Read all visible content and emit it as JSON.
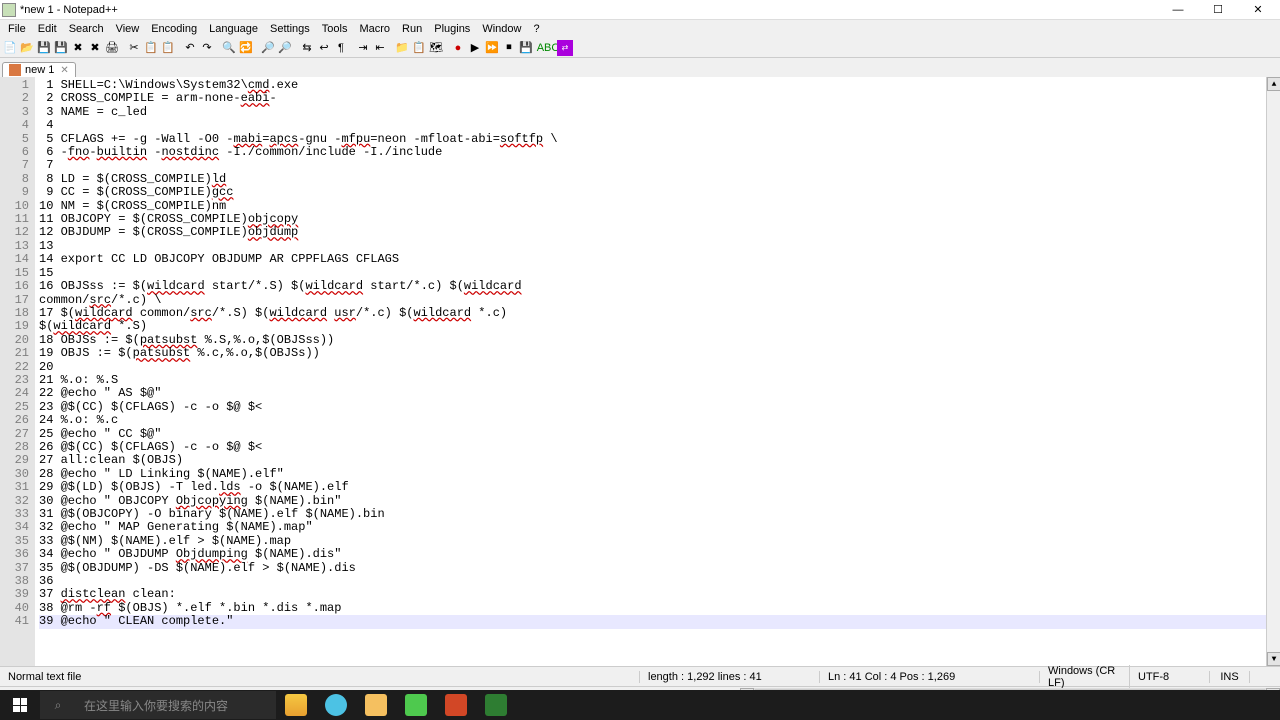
{
  "window": {
    "title": "*new 1 - Notepad++"
  },
  "menu": {
    "file": "File",
    "edit": "Edit",
    "search": "Search",
    "view": "View",
    "encoding": "Encoding",
    "language": "Language",
    "settings": "Settings",
    "tools": "Tools",
    "macro": "Macro",
    "run": "Run",
    "plugins": "Plugins",
    "window": "Window",
    "help": "?"
  },
  "tab": {
    "name": "new 1"
  },
  "gutter": [
    "1",
    "2",
    "3",
    "4",
    "5",
    "6",
    "7",
    "8",
    "9",
    "10",
    "11",
    "12",
    "13",
    "14",
    "15",
    "16",
    "17",
    "18",
    "19",
    "20",
    "21",
    "22",
    "23",
    "24",
    "25",
    "26",
    "27",
    "28",
    "29",
    "30",
    "31",
    "32",
    "33",
    "34",
    "35",
    "36",
    "37",
    "38",
    "39",
    "40",
    "41"
  ],
  "lines": [
    " 1 SHELL=C:\\Windows\\System32\\cmd.exe",
    " 2 CROSS_COMPILE = arm-none-eabi-",
    " 3 NAME = c_led",
    " 4",
    " 5 CFLAGS += -g -Wall -O0 -mabi=apcs-gnu -mfpu=neon -mfloat-abi=softfp \\",
    " 6 -fno-builtin -nostdinc -I./common/include -I./include",
    " 7",
    " 8 LD = $(CROSS_COMPILE)ld",
    " 9 CC = $(CROSS_COMPILE)gcc",
    "10 NM = $(CROSS_COMPILE)nm",
    "11 OBJCOPY = $(CROSS_COMPILE)objcopy",
    "12 OBJDUMP = $(CROSS_COMPILE)objdump",
    "13",
    "14 export CC LD OBJCOPY OBJDUMP AR CPPFLAGS CFLAGS",
    "15",
    "16 OBJSss := $(wildcard start/*.S) $(wildcard start/*.c) $(wildcard",
    "common/src/*.c) \\",
    "17 $(wildcard common/src/*.S) $(wildcard usr/*.c) $(wildcard *.c)",
    "$(wildcard *.S)",
    "18 OBJSs := $(patsubst %.S,%.o,$(OBJSss))",
    "19 OBJS := $(patsubst %.c,%.o,$(OBJSs))",
    "20",
    "21 %.o: %.S",
    "22 @echo \" AS $@\"",
    "23 @$(CC) $(CFLAGS) -c -o $@ $<",
    "24 %.o: %.c",
    "25 @echo \" CC $@\"",
    "26 @$(CC) $(CFLAGS) -c -o $@ $<",
    "27 all:clean $(OBJS)",
    "28 @echo \" LD Linking $(NAME).elf\"",
    "29 @$(LD) $(OBJS) -T led.lds -o $(NAME).elf",
    "30 @echo \" OBJCOPY Objcopying $(NAME).bin\"",
    "31 @$(OBJCOPY) -O binary $(NAME).elf $(NAME).bin",
    "32 @echo \" MAP Generating $(NAME).map\"",
    "33 @$(NM) $(NAME).elf > $(NAME).map",
    "34 @echo \" OBJDUMP Objdumping $(NAME).dis\"",
    "35 @$(OBJDUMP) -DS $(NAME).elf > $(NAME).dis",
    "36",
    "37 distclean clean:",
    "38 @rm -rf $(OBJS) *.elf *.bin *.dis *.map",
    "39 @echo \" CLEAN complete.\""
  ],
  "status": {
    "filetype": "Normal text file",
    "length": "length : 1,292    lines : 41",
    "pos": "Ln : 41    Col : 4    Pos : 1,269",
    "eol": "Windows (CR LF)",
    "enc": "UTF-8",
    "ins": "INS"
  },
  "search": {
    "placeholder": "在这里输入你要搜索的内容"
  }
}
